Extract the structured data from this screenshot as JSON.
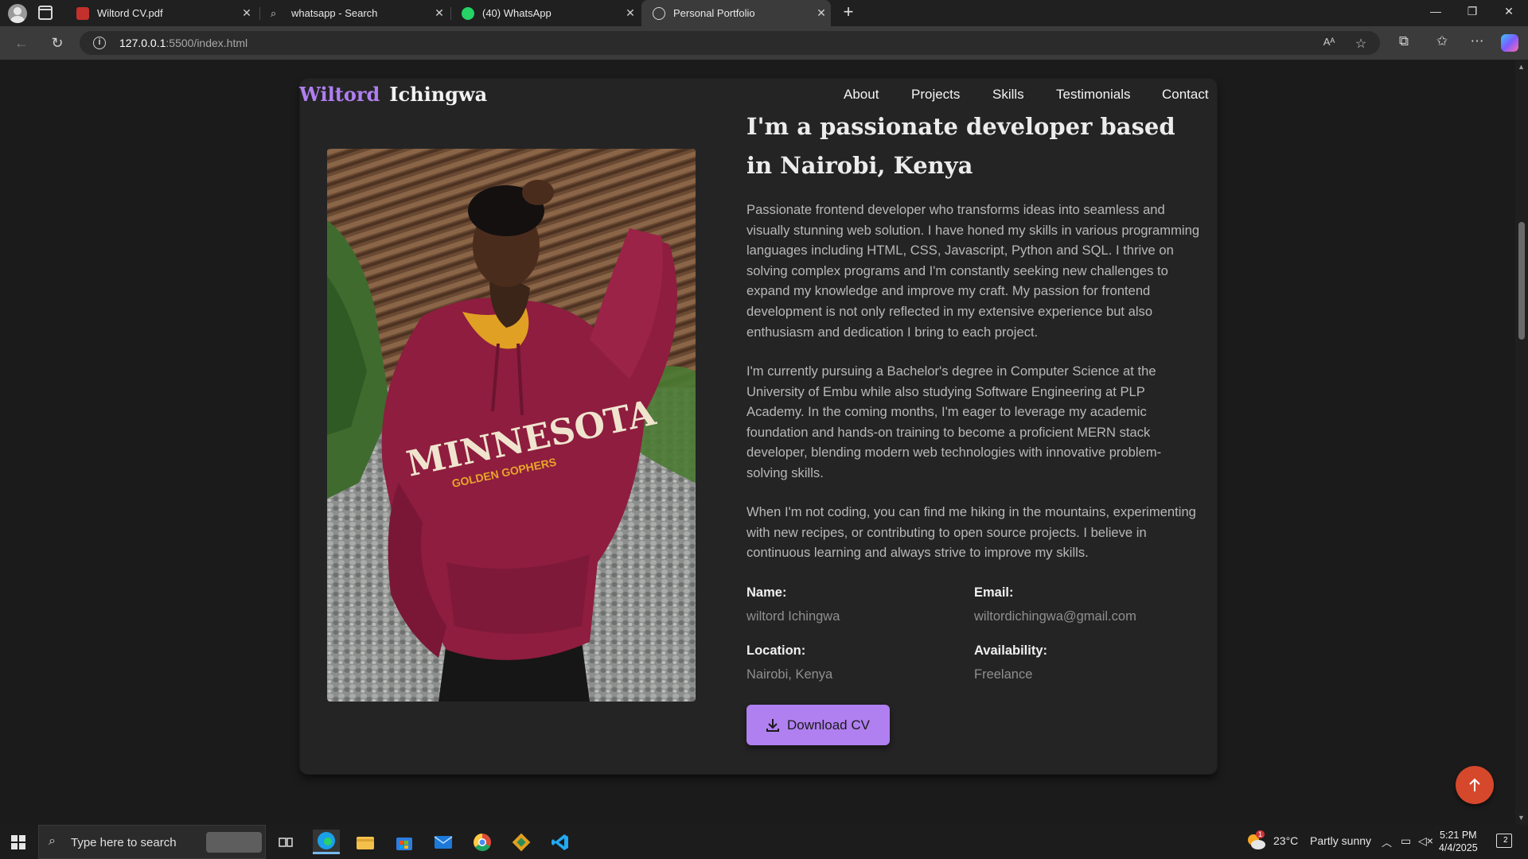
{
  "browser": {
    "tabs": [
      {
        "title": "Wiltord CV.pdf",
        "icon": "pdf-icon"
      },
      {
        "title": "whatsapp - Search",
        "icon": "search-icon"
      },
      {
        "title": "(40) WhatsApp",
        "icon": "whatsapp-icon"
      },
      {
        "title": "Personal Portfolio",
        "icon": "globe-icon",
        "active": true
      }
    ],
    "url_host": "127.0.0.1",
    "url_rest": ":5500/index.html",
    "reader_label": "Aᴬ"
  },
  "site": {
    "brand_first": "Wiltord",
    "brand_last": "Ichingwa",
    "nav": [
      "About",
      "Projects",
      "Skills",
      "Testimonials",
      "Contact"
    ],
    "heading": "I'm a passionate developer based in Nairobi, Kenya",
    "paragraphs": [
      "Passionate frontend developer who transforms ideas into seamless and visually stunning web solution. I have honed my skills in various programming languages including HTML, CSS, Javascript, Python and SQL. I thrive on solving complex programs and I'm constantly seeking new challenges to expand my knowledge and improve my craft. My passion for frontend development is not only reflected in my extensive experience but also enthusiasm and dedication I bring to each project.",
      "I'm currently pursuing a Bachelor's degree in Computer Science at the University of Embu while also studying Software Engineering at PLP Academy. In the coming months, I'm eager to leverage my academic foundation and hands-on training to become a proficient MERN stack developer, blending modern web technologies with innovative problem-solving skills.",
      "When I'm not coding, you can find me hiking in the mountains, experimenting with new recipes, or contributing to open source projects. I believe in continuous learning and always strive to improve my skills."
    ],
    "info": {
      "name_label": "Name:",
      "name_value": "wiltord Ichingwa",
      "email_label": "Email:",
      "email_value": "wiltordichingwa@gmail.com",
      "location_label": "Location:",
      "location_value": "Nairobi, Kenya",
      "availability_label": "Availability:",
      "availability_value": "Freelance"
    },
    "download_label": "Download CV",
    "accent": "#b07ff0",
    "back_to_top_color": "#d6482b",
    "hoodie_text_1": "MINNESOTA",
    "hoodie_text_2": "GOLDEN GOPHERS"
  },
  "taskbar": {
    "search_placeholder": "Type here to search",
    "weather_temp": "23°C",
    "weather_desc": "Partly sunny",
    "weather_badge": "1",
    "time": "5:21 PM",
    "date": "4/4/2025",
    "notification_count": "2"
  }
}
